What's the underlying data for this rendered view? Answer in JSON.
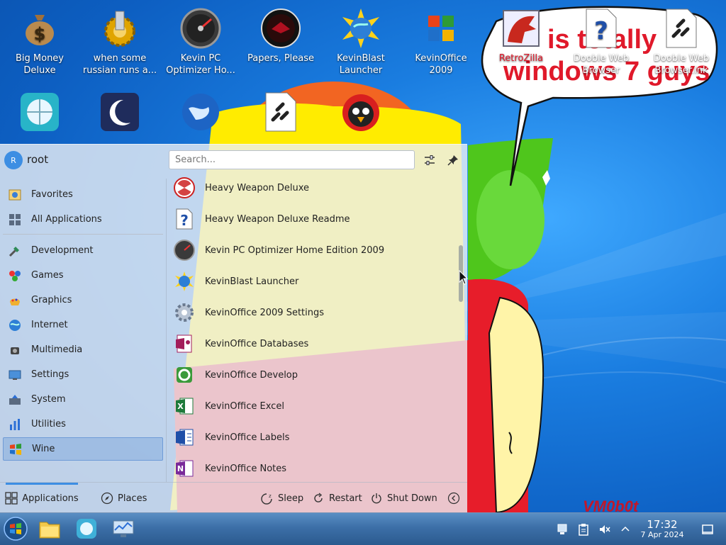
{
  "desktop": {
    "icons_row1": [
      {
        "label": "Big Money\nDeluxe",
        "icon": "money-bag-icon"
      },
      {
        "label": "when some\nrussian runs a...",
        "icon": "gear-icon"
      },
      {
        "label": "Kevin PC\nOptimizer Ho...",
        "icon": "gauge-icon"
      },
      {
        "label": "Papers, Please",
        "icon": "papers-please-icon"
      },
      {
        "label": "KevinBlast\nLauncher",
        "icon": "blast-globe-icon"
      },
      {
        "label": "KevinOffice\n2009",
        "icon": "office-logo-icon"
      },
      {
        "label": "RetroZilla",
        "icon": "retrozilla-icon"
      },
      {
        "label": "Dooble Web\nBrowser",
        "icon": "question-doc-icon"
      },
      {
        "label": "Dooble Web\nBrowser.lnk",
        "icon": "link-doc-icon"
      }
    ],
    "icons_row2": [
      {
        "icon": "globe-icon"
      },
      {
        "icon": "moon-icon"
      },
      {
        "icon": "earth-icon"
      },
      {
        "icon": "link-doc-icon"
      },
      {
        "icon": "angry-bird-icon"
      }
    ],
    "bubble_text_line1": "is totally",
    "bubble_text_line2": "windows 7 guys",
    "vm_tag": "VM0b0t"
  },
  "menu": {
    "user": {
      "initial": "R",
      "name": "root"
    },
    "search": {
      "placeholder": "Search..."
    },
    "categories": [
      {
        "label": "Favorites",
        "icon": "favorites-icon"
      },
      {
        "label": "All Applications",
        "icon": "all-apps-icon"
      },
      {
        "label": "Development",
        "icon": "development-icon"
      },
      {
        "label": "Games",
        "icon": "games-icon"
      },
      {
        "label": "Graphics",
        "icon": "graphics-icon"
      },
      {
        "label": "Internet",
        "icon": "internet-icon"
      },
      {
        "label": "Multimedia",
        "icon": "multimedia-icon"
      },
      {
        "label": "Settings",
        "icon": "settings-icon"
      },
      {
        "label": "System",
        "icon": "system-icon"
      },
      {
        "label": "Utilities",
        "icon": "utilities-icon"
      },
      {
        "label": "Wine",
        "icon": "wine-icon",
        "selected": true
      }
    ],
    "apps": [
      {
        "label": "Heavy Weapon Deluxe",
        "icon": "radiation-icon"
      },
      {
        "label": "Heavy Weapon Deluxe Readme",
        "icon": "question-doc-icon"
      },
      {
        "label": "Kevin PC Optimizer Home Edition 2009",
        "icon": "gauge-icon"
      },
      {
        "label": "KevinBlast Launcher",
        "icon": "blast-globe-icon"
      },
      {
        "label": "KevinOffice 2009 Settings",
        "icon": "gear-icon"
      },
      {
        "label": "KevinOffice Databases",
        "icon": "access-icon"
      },
      {
        "label": "KevinOffice Develop",
        "icon": "develop-icon"
      },
      {
        "label": "KevinOffice Excel",
        "icon": "excel-icon"
      },
      {
        "label": "KevinOffice Labels",
        "icon": "labels-icon"
      },
      {
        "label": "KevinOffice Notes",
        "icon": "onenote-icon"
      }
    ],
    "footer": {
      "applications": "Applications",
      "places": "Places",
      "sleep": "Sleep",
      "restart": "Restart",
      "shutdown": "Shut Down"
    }
  },
  "taskbar": {
    "items": [
      "start-orb-icon",
      "file-manager-icon",
      "browser-icon",
      "system-monitor-icon"
    ],
    "tray": [
      "network-icon",
      "clipboard-icon",
      "volume-muted-icon",
      "expand-tray-icon"
    ],
    "time": "17:32",
    "date": "7 Apr 2024"
  },
  "colors": {
    "accent": "#3d8ee3",
    "bubble_text": "#e0192a",
    "taskbar": "#3c6fa7"
  }
}
